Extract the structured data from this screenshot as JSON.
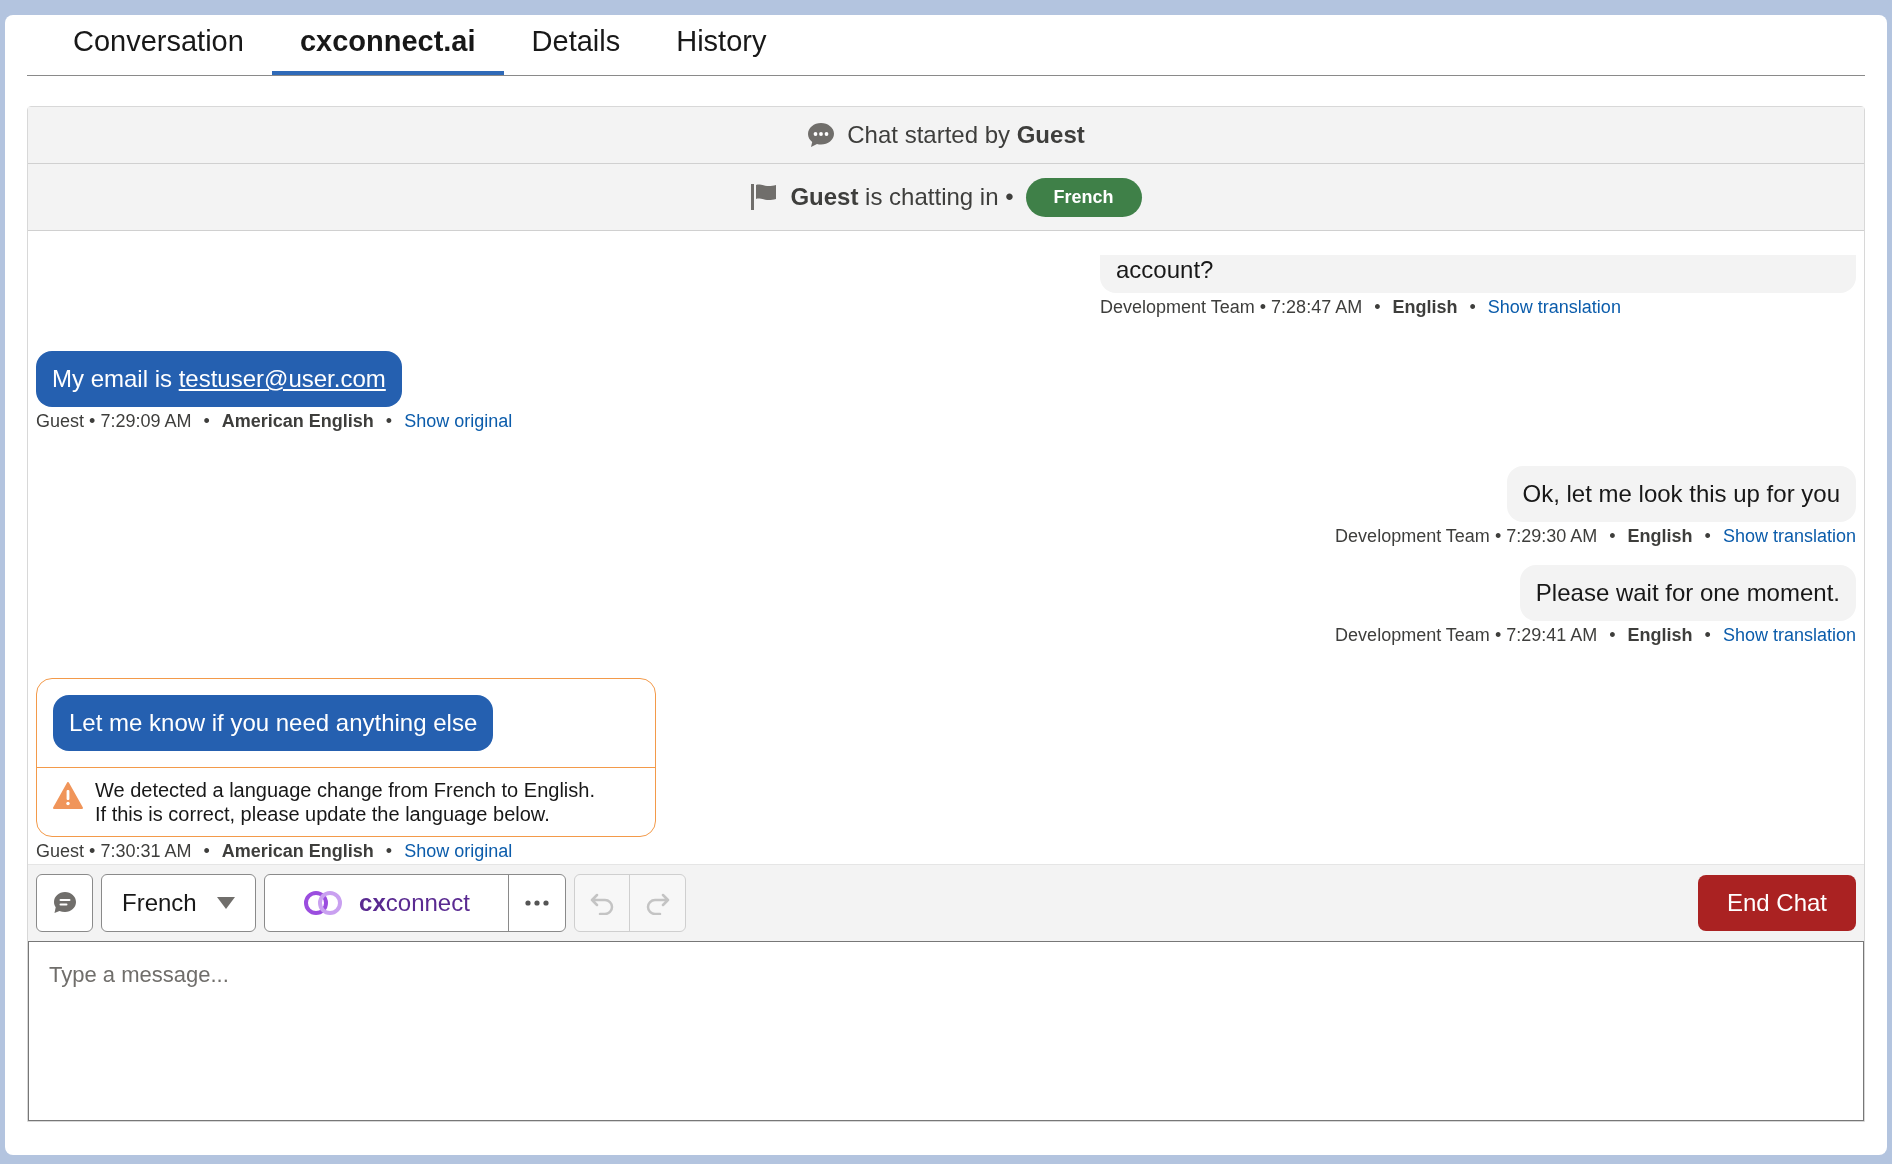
{
  "tabs": [
    {
      "label": "Conversation",
      "selected": false
    },
    {
      "label": "cxconnect.ai",
      "selected": true
    },
    {
      "label": "Details",
      "selected": false
    },
    {
      "label": "History",
      "selected": false
    }
  ],
  "chat_header": {
    "started_prefix": "Chat started by",
    "started_by": "Guest",
    "chatter": "Guest",
    "chatting_text": "is chatting in",
    "language_badge": "French"
  },
  "separator": "•",
  "messages": [
    {
      "kind": "agent",
      "cut_top": true,
      "text": "account?",
      "sender": "Development Team",
      "time": "7:28:47 AM",
      "language": "English",
      "action": "Show translation"
    },
    {
      "kind": "guest",
      "cut_top": false,
      "text": "My email is ",
      "link": "testuser@user.com",
      "sender": "Guest",
      "time": "7:29:09 AM",
      "language": "American English",
      "action": "Show original"
    },
    {
      "kind": "agent",
      "cut_top": false,
      "text": "Ok, let me look this up for you",
      "sender": "Development Team",
      "time": "7:29:30 AM",
      "language": "English",
      "action": "Show translation"
    },
    {
      "kind": "agent",
      "cut_top": false,
      "text": "Please wait for one moment.",
      "sender": "Development Team",
      "time": "7:29:41 AM",
      "language": "English",
      "action": "Show translation"
    },
    {
      "kind": "guest",
      "cut_top": false,
      "text": "Let me know if you need anything else",
      "warning": [
        "We detected a language change from French to English.",
        "If this is correct, please update the language below."
      ],
      "sender": "Guest",
      "time": "7:30:31 AM",
      "language": "American English",
      "action": "Show original"
    }
  ],
  "toolbar": {
    "language": "French",
    "brand_prefix": "cx",
    "brand_rest": "connect",
    "end_button": "End Chat"
  },
  "composer": {
    "placeholder": "Type a message..."
  }
}
